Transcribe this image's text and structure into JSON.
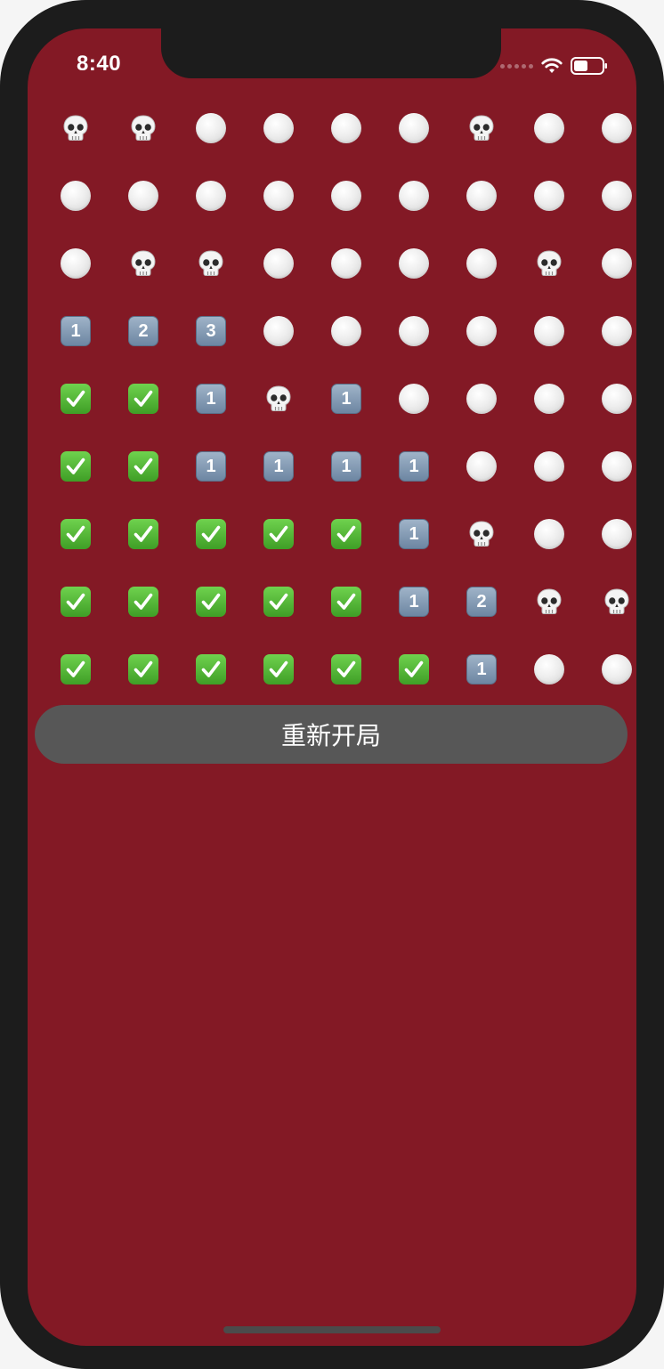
{
  "status_bar": {
    "time": "8:40",
    "icons": [
      "cellular-signal-icon",
      "wifi-icon",
      "battery-icon"
    ],
    "battery_level": 0.5
  },
  "colors": {
    "screen_background": "#831925",
    "device_frame": "#1c1c1c",
    "button_background": "#575757"
  },
  "board": {
    "rows": 9,
    "columns": 9,
    "cell_legend": {
      "hidden": "white-circle",
      "mine": "skull",
      "safe": "check-mark-button",
      "number": "keycap-digit"
    },
    "cells": [
      [
        "mine",
        "mine",
        "hidden",
        "hidden",
        "hidden",
        "hidden",
        "mine",
        "hidden",
        "hidden"
      ],
      [
        "hidden",
        "hidden",
        "hidden",
        "hidden",
        "hidden",
        "hidden",
        "hidden",
        "hidden",
        "hidden"
      ],
      [
        "hidden",
        "mine",
        "mine",
        "hidden",
        "hidden",
        "hidden",
        "hidden",
        "mine",
        "hidden"
      ],
      [
        "1",
        "2",
        "3",
        "hidden",
        "hidden",
        "hidden",
        "hidden",
        "hidden",
        "hidden"
      ],
      [
        "safe",
        "safe",
        "1",
        "mine",
        "1",
        "hidden",
        "hidden",
        "hidden",
        "hidden"
      ],
      [
        "safe",
        "safe",
        "1",
        "1",
        "1",
        "1",
        "hidden",
        "hidden",
        "hidden"
      ],
      [
        "safe",
        "safe",
        "safe",
        "safe",
        "safe",
        "1",
        "mine",
        "hidden",
        "hidden"
      ],
      [
        "safe",
        "safe",
        "safe",
        "safe",
        "safe",
        "1",
        "2",
        "mine",
        "mine"
      ],
      [
        "safe",
        "safe",
        "safe",
        "safe",
        "safe",
        "safe",
        "1",
        "hidden",
        "hidden"
      ]
    ]
  },
  "restart_button": {
    "label": "重新开局"
  }
}
